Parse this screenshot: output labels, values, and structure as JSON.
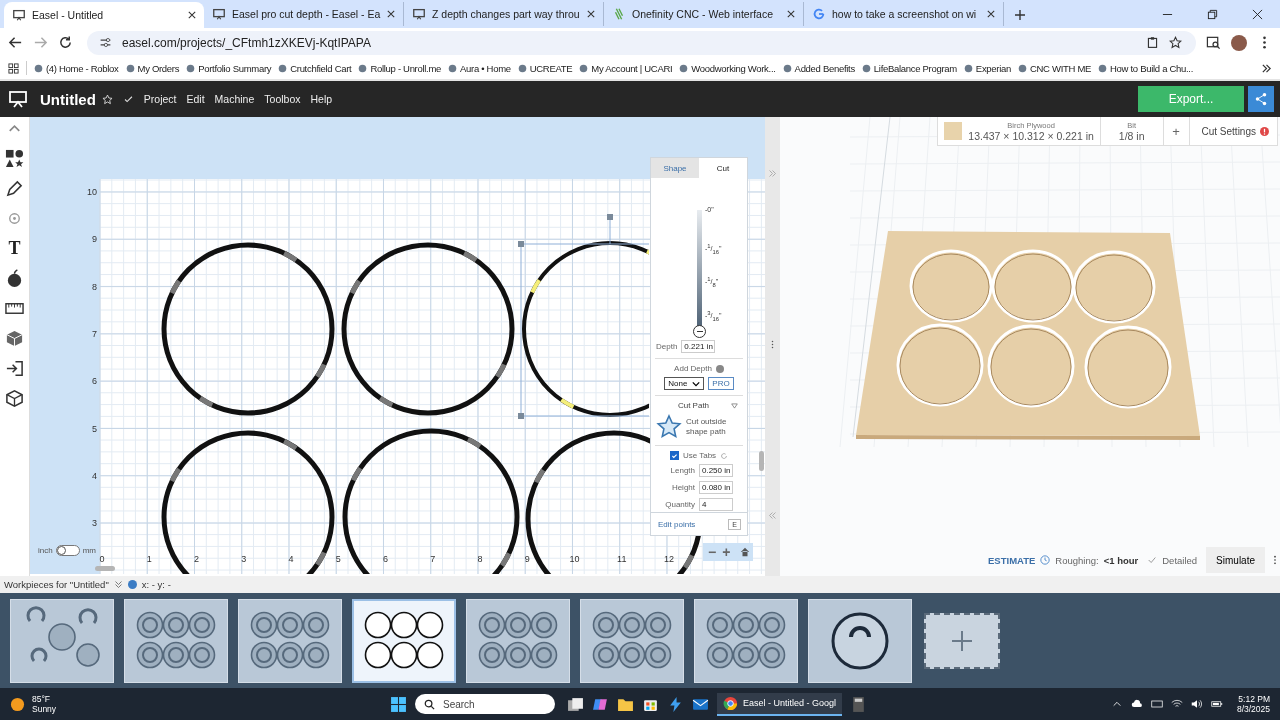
{
  "browser": {
    "tabs": [
      {
        "title": "Easel - Untitled",
        "kind": "easel",
        "selected": true
      },
      {
        "title": "Easel pro cut depth - Easel - Ea",
        "kind": "easel",
        "selected": false
      },
      {
        "title": "Z depth changes part way throu",
        "kind": "easel",
        "selected": false
      },
      {
        "title": "Onefinity CNC - Web interface",
        "kind": "onefinity",
        "selected": false
      },
      {
        "title": "how to take a screenshot on wi",
        "kind": "google",
        "selected": false
      }
    ],
    "url": "easel.com/projects/_CFtmh1zXKEVj-KqtIPAPA",
    "bookmarks": [
      "(4) Home - Roblox",
      "My Orders",
      "Portfolio Summary",
      "Crutchfield Cart",
      "Rollup - Unroll.me",
      "Aura • Home",
      "UCREATE",
      "My Account | UCARI",
      "Woodworking Work...",
      "Added Benefits",
      "LifeBalance Program",
      "Experian",
      "CNC WITH ME",
      "How to Build a Chu..."
    ]
  },
  "app": {
    "title": "Untitled",
    "menu": [
      "Project",
      "Edit",
      "Machine",
      "Toolbox",
      "Help"
    ],
    "export": "Export...",
    "text_tool": "T"
  },
  "canvas": {
    "x_ticks": [
      "0",
      "1",
      "2",
      "3",
      "4",
      "5",
      "6",
      "7",
      "8",
      "9",
      "10",
      "11",
      "12"
    ],
    "y_ticks": [
      "10",
      "9",
      "8",
      "7",
      "6",
      "5",
      "4",
      "3"
    ],
    "shapes": [
      {
        "selected": false
      },
      {
        "selected": false
      },
      {
        "selected": true
      },
      {
        "selected": false
      },
      {
        "selected": false
      },
      {
        "selected": false
      }
    ],
    "unit_left": "inch",
    "unit_right": "mm",
    "metric": false,
    "zoom_out": "−",
    "zoom_in": "+"
  },
  "cut_panel": {
    "tabs": [
      {
        "label": "Shape",
        "selected": false
      },
      {
        "label": "Cut",
        "selected": true
      }
    ],
    "depth_marks": [
      "-0\"",
      "-$^{1}$/$_{16}$\"",
      "-$^{1}$/$_{8}$\"",
      "-$^{3}$/$_{16}$\""
    ],
    "level": 1,
    "depth_label": "Depth",
    "depth_value": "0.221 in",
    "add_depth": "Add Depth",
    "add_depth_value": "None",
    "pro": "PRO",
    "cut_path": "Cut Path",
    "cut_path_desc": "Cut outside shape path",
    "use_tabs": {
      "label": "Use Tabs",
      "checked": true
    },
    "fields": [
      {
        "label": "Length",
        "value": "0.250 in"
      },
      {
        "label": "Height",
        "value": "0.080 in"
      },
      {
        "label": "Quantity",
        "value": "4"
      }
    ],
    "edit_points": "Edit points",
    "edit_key": "E"
  },
  "preview": {
    "material": "Birch Plywood",
    "dimensions": "13.437 × 10.312 × 0.221 in",
    "bit_label": "Bit",
    "bit": "1/8 in",
    "add": "+",
    "cut_settings": "Cut Settings",
    "estimate": "ESTIMATE",
    "roughing": "Roughing:",
    "roughing_value": "<1 hour",
    "detailed": "Detailed",
    "simulate": "Simulate"
  },
  "workpieces": {
    "label": "Workpieces for \"Untitled\"",
    "coords": "x: - y: -",
    "items": [
      {
        "kind": "collage",
        "selected": false
      },
      {
        "kind": "grid",
        "selected": false
      },
      {
        "kind": "grid",
        "selected": false
      },
      {
        "kind": "rings",
        "selected": true
      },
      {
        "kind": "grid",
        "selected": false
      },
      {
        "kind": "grid",
        "selected": false
      },
      {
        "kind": "grid",
        "selected": false
      },
      {
        "kind": "logo",
        "selected": false
      }
    ]
  },
  "taskbar": {
    "temperature": "85°F",
    "condition": "Sunny",
    "search": "Search",
    "app": "Easel - Untitled - Googl",
    "time": "5:12 PM",
    "date": "8/3/2025"
  }
}
